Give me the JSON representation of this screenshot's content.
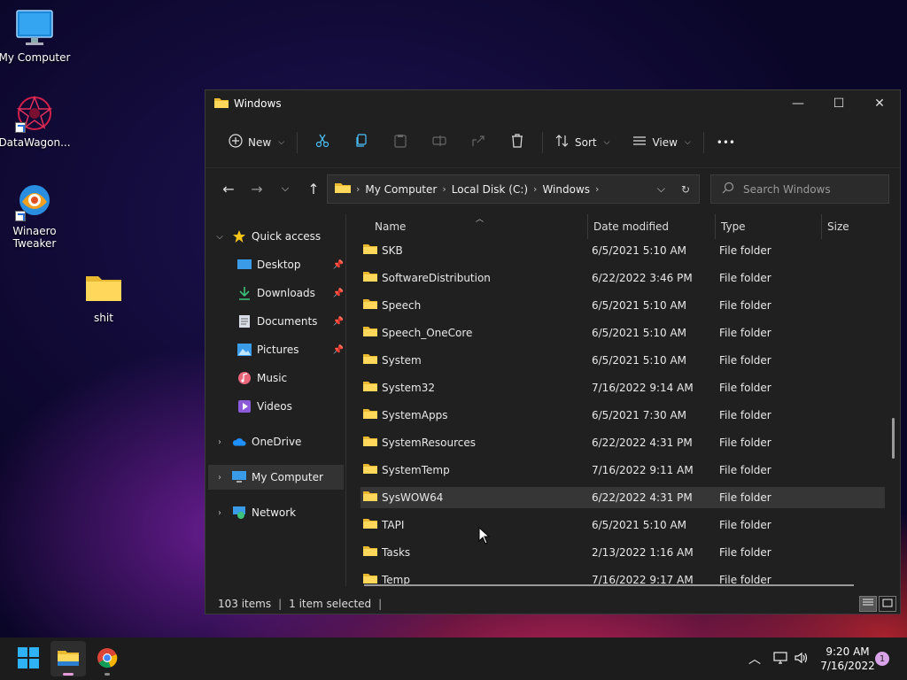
{
  "desktop": {
    "icons": [
      {
        "label": "My Computer",
        "icon": "monitor-icon"
      },
      {
        "label": "DataWagon...",
        "icon": "datawagon-icon"
      },
      {
        "label": "Winaero Tweaker",
        "icon": "winaero-icon"
      },
      {
        "label": "shit",
        "icon": "folder-icon"
      }
    ]
  },
  "window": {
    "title": "Windows",
    "toolbar": {
      "new_label": "New",
      "sort_label": "Sort",
      "view_label": "View",
      "more_label": "•••"
    },
    "address": {
      "crumbs": [
        "My Computer",
        "Local Disk (C:)",
        "Windows"
      ]
    },
    "search": {
      "placeholder": "Search Windows"
    },
    "sidebar": {
      "quick_access": "Quick access",
      "items": [
        {
          "label": "Desktop",
          "icon": "desktop-icon",
          "pinned": true
        },
        {
          "label": "Downloads",
          "icon": "download-icon",
          "pinned": true
        },
        {
          "label": "Documents",
          "icon": "document-icon",
          "pinned": true
        },
        {
          "label": "Pictures",
          "icon": "pictures-icon",
          "pinned": true
        },
        {
          "label": "Music",
          "icon": "music-icon",
          "pinned": false
        },
        {
          "label": "Videos",
          "icon": "video-icon",
          "pinned": false
        }
      ],
      "onedrive": "OneDrive",
      "my_computer": "My Computer",
      "network": "Network"
    },
    "columns": {
      "name": "Name",
      "date": "Date modified",
      "type": "Type",
      "size": "Size"
    },
    "files": [
      {
        "name": "SKB",
        "date": "6/5/2021 5:10 AM",
        "type": "File folder"
      },
      {
        "name": "SoftwareDistribution",
        "date": "6/22/2022 3:46 PM",
        "type": "File folder"
      },
      {
        "name": "Speech",
        "date": "6/5/2021 5:10 AM",
        "type": "File folder"
      },
      {
        "name": "Speech_OneCore",
        "date": "6/5/2021 5:10 AM",
        "type": "File folder"
      },
      {
        "name": "System",
        "date": "6/5/2021 5:10 AM",
        "type": "File folder"
      },
      {
        "name": "System32",
        "date": "7/16/2022 9:14 AM",
        "type": "File folder"
      },
      {
        "name": "SystemApps",
        "date": "6/5/2021 7:30 AM",
        "type": "File folder"
      },
      {
        "name": "SystemResources",
        "date": "6/22/2022 4:31 PM",
        "type": "File folder"
      },
      {
        "name": "SystemTemp",
        "date": "7/16/2022 9:11 AM",
        "type": "File folder"
      },
      {
        "name": "SysWOW64",
        "date": "6/22/2022 4:31 PM",
        "type": "File folder",
        "selected": true
      },
      {
        "name": "TAPI",
        "date": "6/5/2021 5:10 AM",
        "type": "File folder"
      },
      {
        "name": "Tasks",
        "date": "2/13/2022 1:16 AM",
        "type": "File folder"
      },
      {
        "name": "Temp",
        "date": "7/16/2022 9:17 AM",
        "type": "File folder"
      }
    ],
    "status": {
      "items": "103 items",
      "selected": "1 item selected"
    }
  },
  "taskbar": {
    "time": "9:20 AM",
    "date": "7/16/2022",
    "notifications": "1"
  },
  "colors": {
    "accent": "#4cc2ff",
    "folder": "#f4c542",
    "window_bg": "#202020"
  }
}
